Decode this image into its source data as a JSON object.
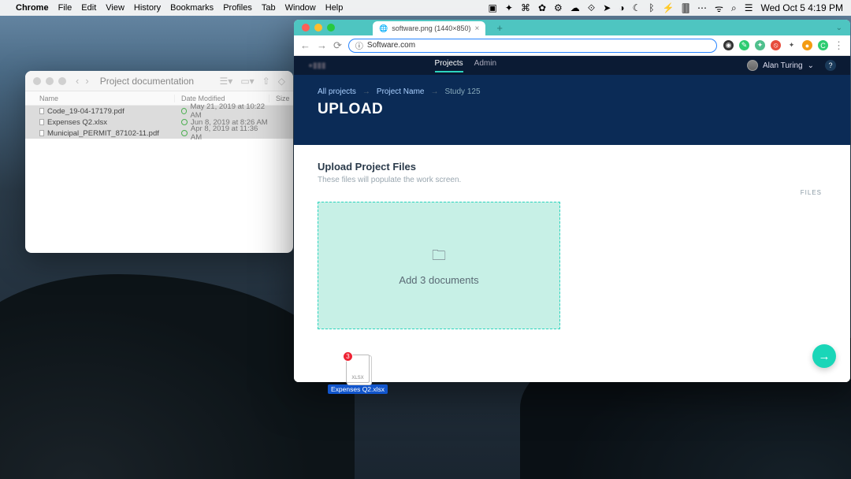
{
  "menubar": {
    "app": "Chrome",
    "items": [
      "File",
      "Edit",
      "View",
      "History",
      "Bookmarks",
      "Profiles",
      "Tab",
      "Window",
      "Help"
    ],
    "clock": "Wed Oct 5  4:19 PM"
  },
  "finder": {
    "title": "Project documentation",
    "columns": {
      "name": "Name",
      "date": "Date Modified",
      "size": "Size"
    },
    "rows": [
      {
        "name": "Code_19-04-17179.pdf",
        "date": "May 21, 2019 at 10:22 AM"
      },
      {
        "name": "Expenses Q2.xlsx",
        "date": "Jun 8, 2019 at 8:26 AM"
      },
      {
        "name": "Municipal_PERMIT_87102-11.pdf",
        "date": "Apr 8, 2019 at 11:36 AM"
      }
    ]
  },
  "browser": {
    "tab_title": "software.png (1440×850)",
    "url": "Software.com",
    "app_nav": {
      "projects": "Projects",
      "admin": "Admin"
    },
    "user_name": "Alan Turing",
    "breadcrumb": {
      "all": "All projects",
      "project": "Project Name",
      "study": "Study 125"
    },
    "page_title": "UPLOAD",
    "section": {
      "heading": "Upload Project Files",
      "sub": "These files will populate the work screen.",
      "files_label": "FILES",
      "dropzone_text": "Add 3 documents"
    }
  },
  "drag": {
    "count": "3",
    "label": "Expenses Q2.xlsx",
    "type": "XLSX"
  }
}
